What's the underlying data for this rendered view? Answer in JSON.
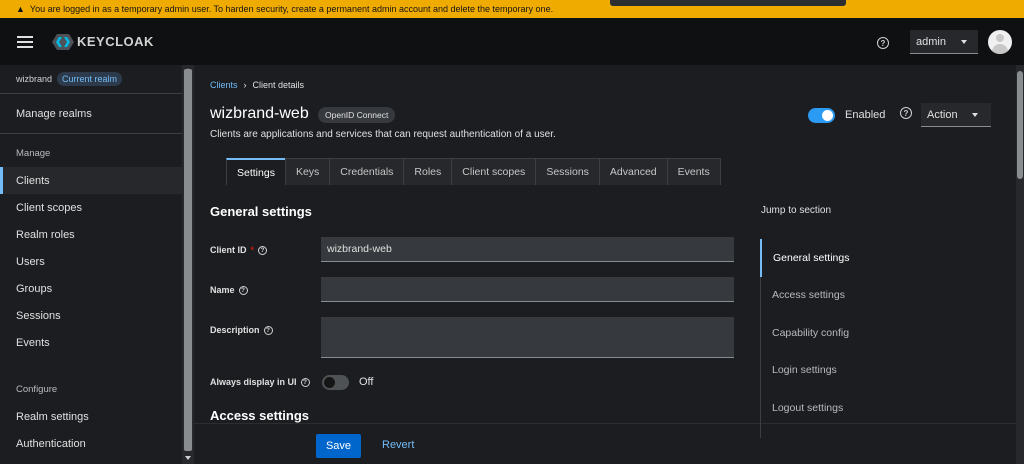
{
  "banner": {
    "icon": "warning-icon",
    "text": "You are logged in as a temporary admin user. To harden security, create a permanent admin account and delete the temporary one."
  },
  "masthead": {
    "logo_text": "KEYCLOAK",
    "user_menu_value": "admin"
  },
  "sidebar": {
    "realm_name": "wizbrand",
    "realm_badge": "Current realm",
    "manage_realms": "Manage realms",
    "group_manage": "Manage",
    "manage_items": [
      "Clients",
      "Client scopes",
      "Realm roles",
      "Users",
      "Groups",
      "Sessions",
      "Events"
    ],
    "group_configure": "Configure",
    "configure_items": [
      "Realm settings",
      "Authentication"
    ]
  },
  "breadcrumb": {
    "parent": "Clients",
    "current": "Client details"
  },
  "header": {
    "title": "wizbrand-web",
    "protocol": "OpenID Connect",
    "subtitle": "Clients are applications and services that can request authentication of a user.",
    "enabled_label": "Enabled",
    "action_label": "Action"
  },
  "tabs": [
    "Settings",
    "Keys",
    "Credentials",
    "Roles",
    "Client scopes",
    "Sessions",
    "Advanced",
    "Events"
  ],
  "form": {
    "section_general": "General settings",
    "client_id_label": "Client ID",
    "client_id_value": "wizbrand-web",
    "name_label": "Name",
    "name_value": "",
    "description_label": "Description",
    "description_value": "",
    "always_display_label": "Always display in UI",
    "always_display_value": "Off",
    "section_access": "Access settings"
  },
  "footer": {
    "save": "Save",
    "revert": "Revert"
  },
  "jump": {
    "title": "Jump to section",
    "items": [
      "General settings",
      "Access settings",
      "Capability config",
      "Login settings",
      "Logout settings"
    ]
  },
  "colors": {
    "accent": "#73bcf7",
    "primary_button": "#0066cc",
    "warning": "#f0ab00",
    "toggle_on": "#2b9af3"
  }
}
